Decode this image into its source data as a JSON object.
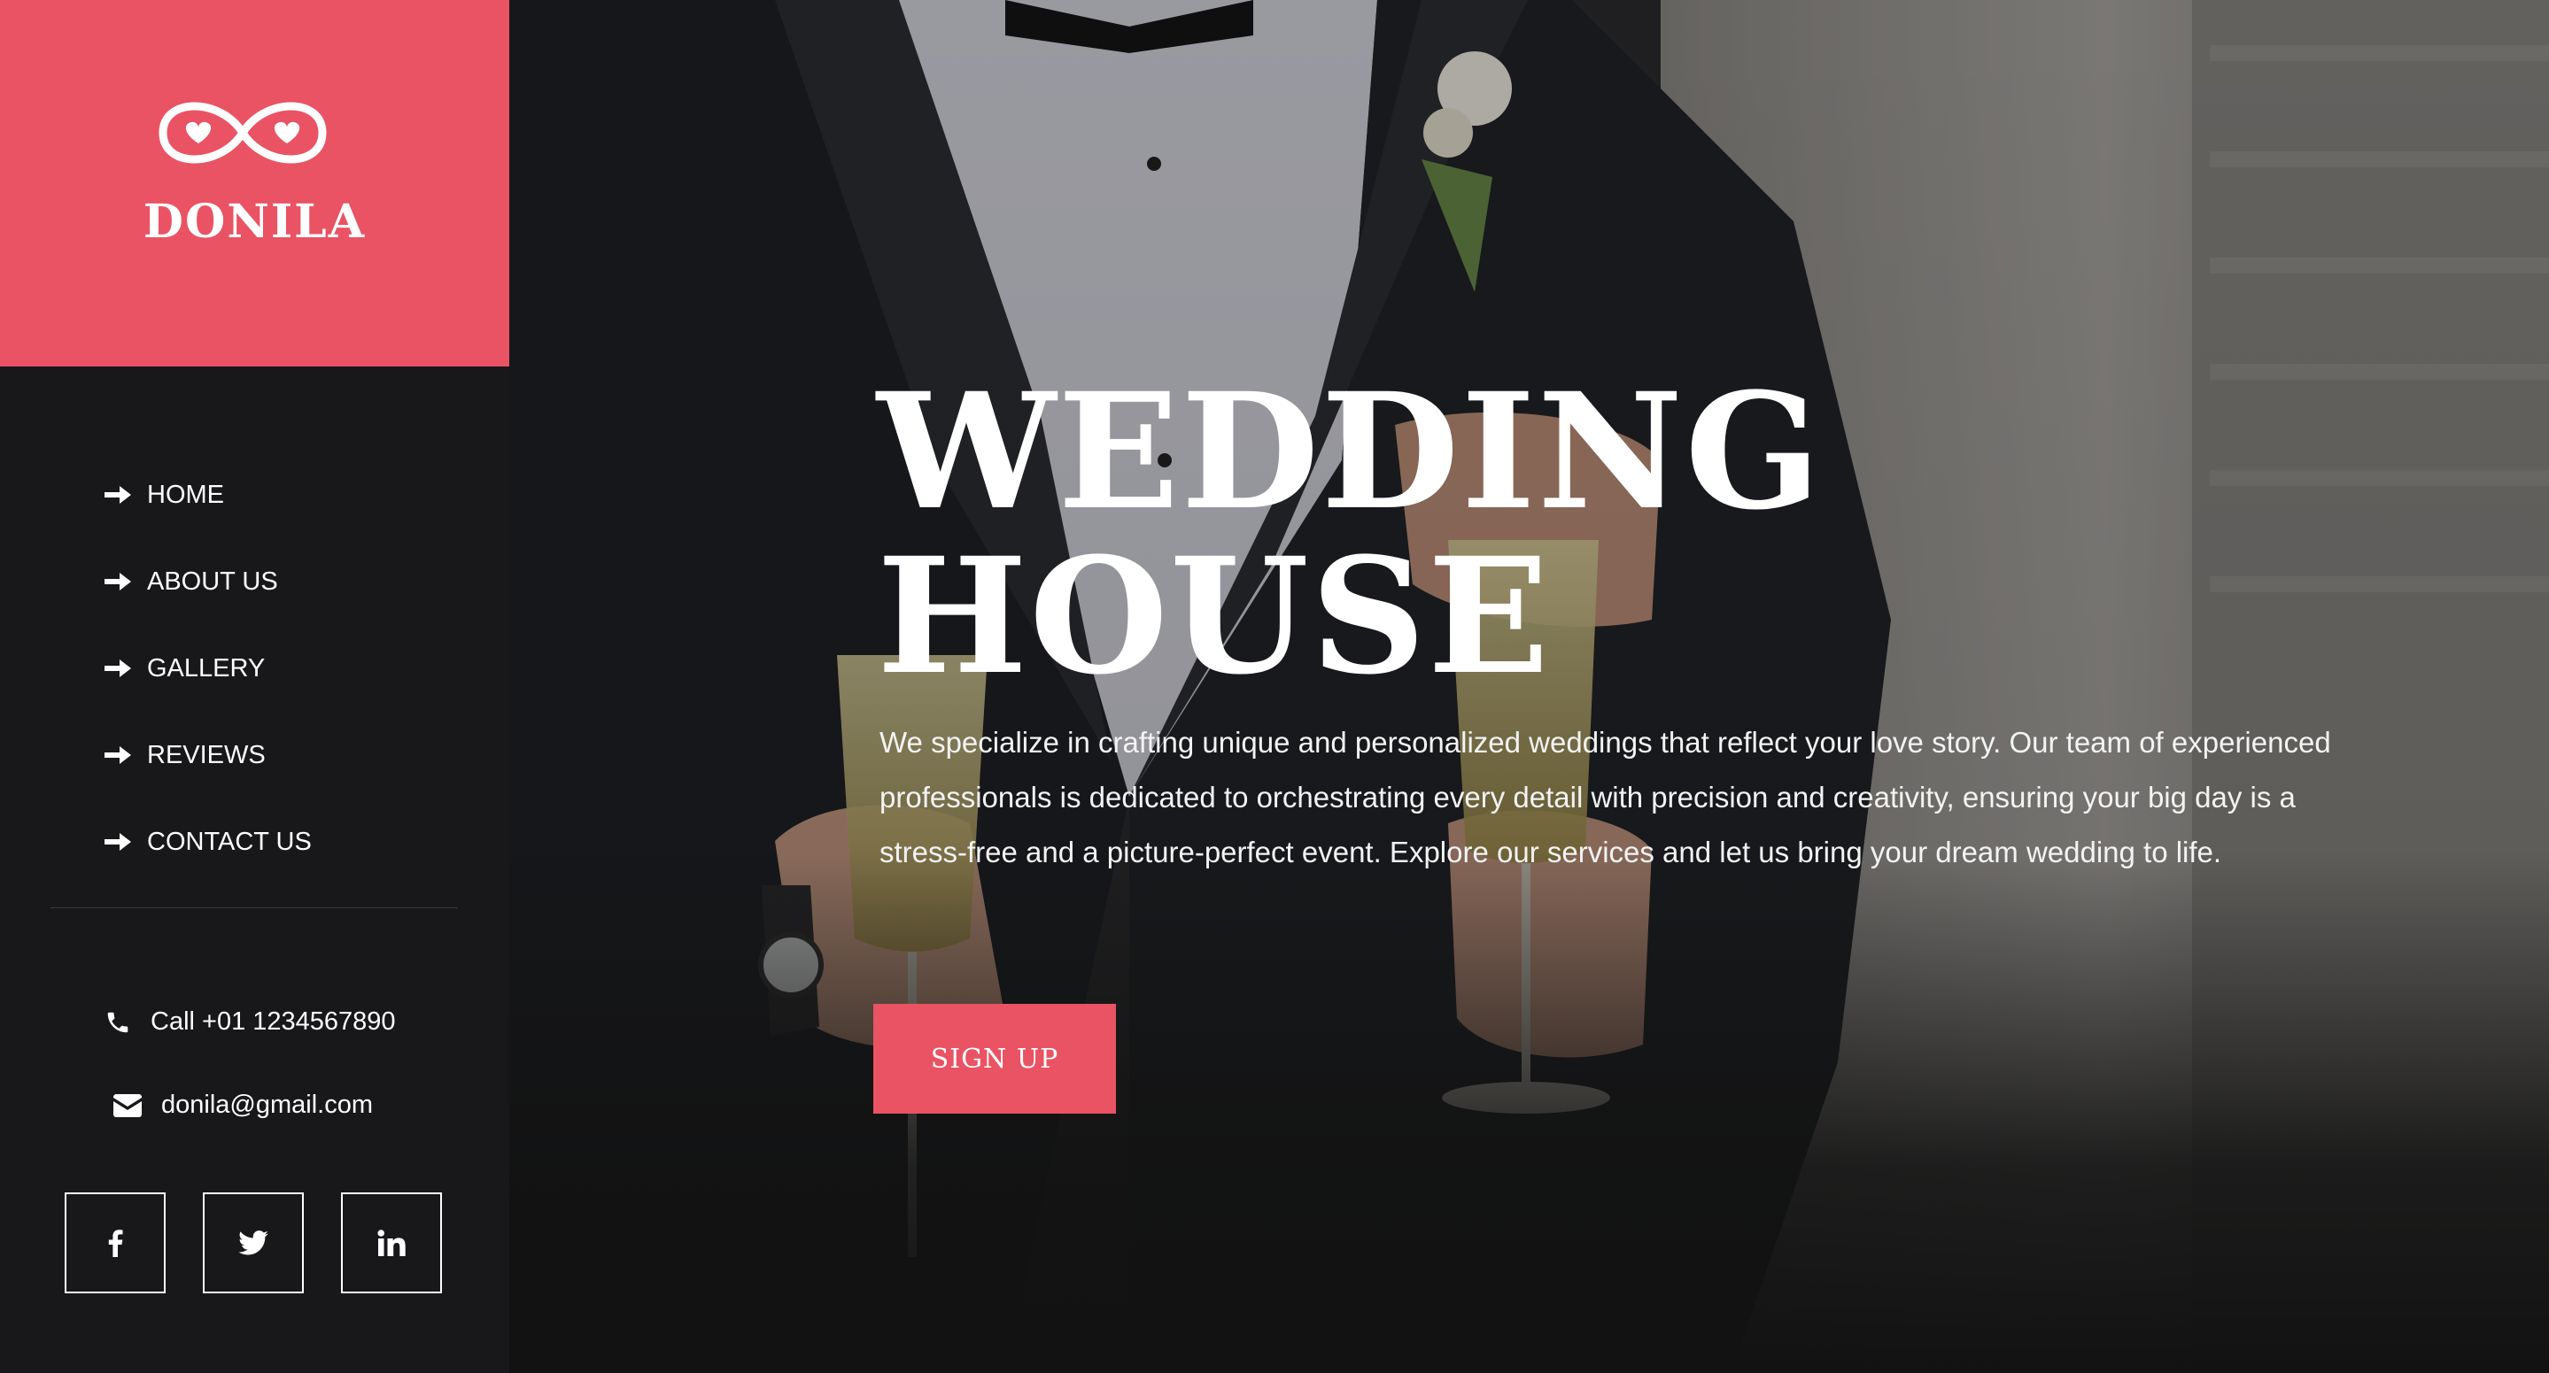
{
  "brand": {
    "name": "DONILA",
    "logo_icon": "infinity-hearts-icon",
    "color": "#ea5363"
  },
  "nav": {
    "items": [
      {
        "label": "HOME",
        "icon": "arrow-right-icon"
      },
      {
        "label": "ABOUT US",
        "icon": "arrow-right-icon"
      },
      {
        "label": "GALLERY",
        "icon": "arrow-right-icon"
      },
      {
        "label": "REVIEWS",
        "icon": "arrow-right-icon"
      },
      {
        "label": "CONTACT US",
        "icon": "arrow-right-icon"
      }
    ]
  },
  "contact": {
    "phone": "Call +01 1234567890",
    "phone_icon": "phone-icon",
    "email": "donila@gmail.com",
    "email_icon": "envelope-icon"
  },
  "socials": [
    {
      "icon": "facebook-icon"
    },
    {
      "icon": "twitter-icon"
    },
    {
      "icon": "linkedin-icon"
    }
  ],
  "hero": {
    "title_line1": "WEDDING",
    "title_line2": "HOUSE",
    "description": "We specialize in crafting unique and personalized weddings that reflect your love story. Our team of experienced professionals is dedicated to orchestrating every detail with precision and creativity, ensuring your big day is a stress-free and a picture-perfect event. Explore our services and let us bring your dream wedding to life.",
    "cta_label": "SIGN UP",
    "background": "wedding-couple-champagne-photo"
  },
  "colors": {
    "accent": "#ea5363",
    "sidebar_bg": "#18181a",
    "text": "#ffffff"
  }
}
